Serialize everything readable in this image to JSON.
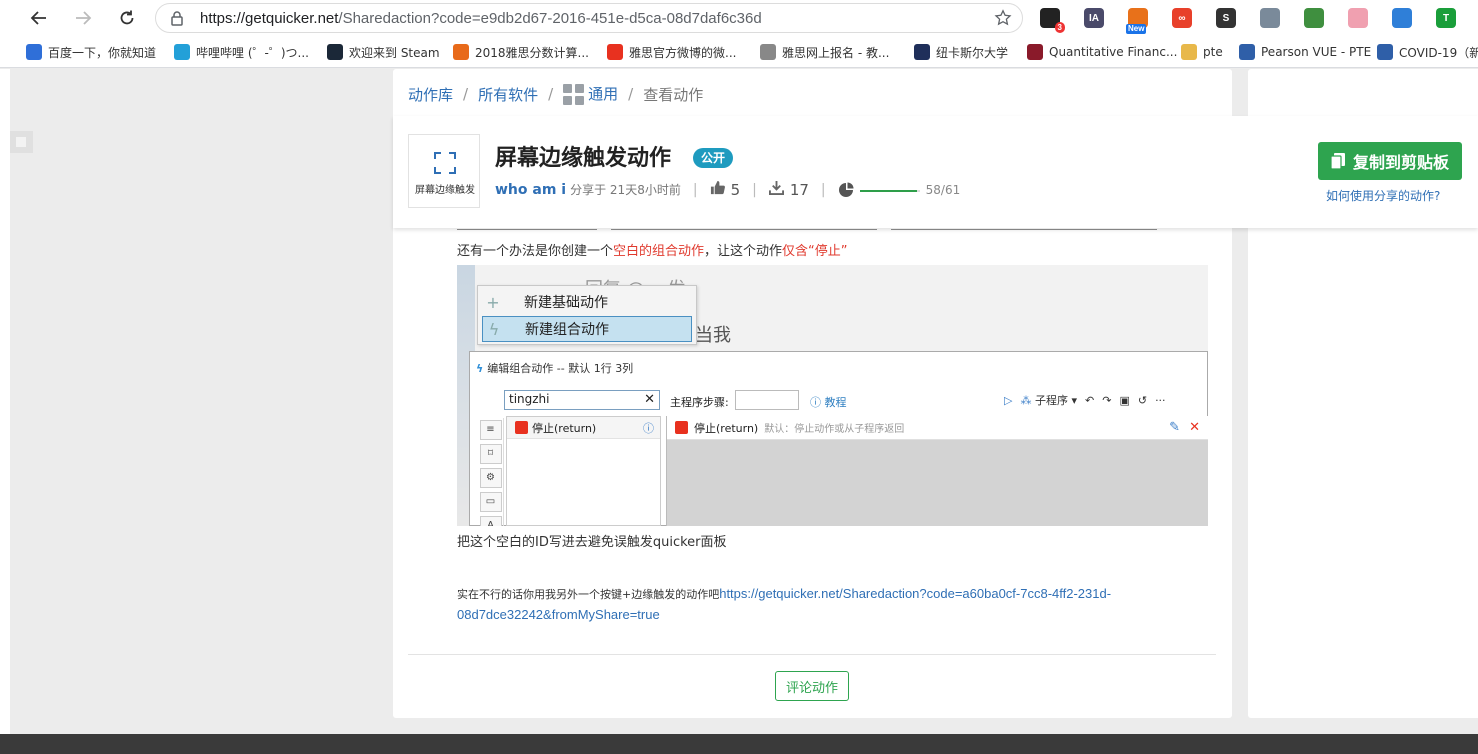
{
  "browser": {
    "url_host": "https://getquicker.net",
    "url_rest": "/Sharedaction?code=e9db2d67-2016-451e-d5ca-08d7daf6c36d",
    "extensions": [
      {
        "name": "extension-1-icon",
        "text": "",
        "color": "#222222",
        "badge": "3"
      },
      {
        "name": "extension-ia-icon",
        "text": "IA",
        "color": "#4a4a6a",
        "badge": ""
      },
      {
        "name": "extension-new-icon",
        "text": "",
        "color": "#e8711a",
        "badge": "New"
      },
      {
        "name": "extension-infinity-icon",
        "text": "∞",
        "color": "#e8402a",
        "badge": ""
      },
      {
        "name": "extension-s-icon",
        "text": "S",
        "color": "#333333",
        "badge": ""
      },
      {
        "name": "extension-chart-icon",
        "text": "",
        "color": "#7a8a9a",
        "badge": ""
      },
      {
        "name": "extension-globe-icon",
        "text": "",
        "color": "#3f8f3f",
        "badge": ""
      },
      {
        "name": "extension-cat-icon",
        "text": "",
        "color": "#f0a0b0",
        "badge": ""
      },
      {
        "name": "extension-earth-icon",
        "text": "",
        "color": "#2f7fd8",
        "badge": ""
      },
      {
        "name": "extension-shield-icon",
        "text": "T",
        "color": "#1a9e3a",
        "badge": ""
      }
    ]
  },
  "bookmarks": [
    {
      "label": "百度一下，你就知道",
      "icon": "paw-icon",
      "color": "#2f6fd8"
    },
    {
      "label": "哔哩哔哩 (゜-゜)つ...",
      "icon": "tv-icon",
      "color": "#23a0d8"
    },
    {
      "label": "欢迎来到 Steam",
      "icon": "steam-icon",
      "color": "#1b2838"
    },
    {
      "label": "2018雅思分数计算...",
      "icon": "headphones-icon",
      "color": "#e86a1a"
    },
    {
      "label": "雅思官方微博的微...",
      "icon": "weibo-icon",
      "color": "#e8311f"
    },
    {
      "label": "雅思网上报名 - 教...",
      "icon": "page-icon",
      "color": "#888888"
    },
    {
      "label": "纽卡斯尔大学",
      "icon": "crest-icon",
      "color": "#1f2f5a"
    },
    {
      "label": "Quantitative Financ...",
      "icon": "crest-icon",
      "color": "#8a1a2a"
    },
    {
      "label": "pte",
      "icon": "folder-icon",
      "color": "#e8b84a"
    },
    {
      "label": "Pearson VUE - PTE",
      "icon": "pearson-icon",
      "color": "#2f5fa8"
    },
    {
      "label": "COVID-19（新",
      "icon": "pearson-icon",
      "color": "#2f5fa8"
    }
  ],
  "breadcrumb": {
    "library": "动作库",
    "all_software": "所有软件",
    "general": "通用",
    "current": "查看动作"
  },
  "action": {
    "thumb_label": "屏幕边缘触发",
    "title": "屏幕边缘触发动作",
    "badge": "公开",
    "author": "who am i",
    "shared_time": "分享于 21天8小时前",
    "likes": "5",
    "downloads": "17",
    "progress_text": "58/61",
    "progress_fraction": 0.951,
    "copy_button": "复制到剪贴板",
    "help_link": "如何使用分享的动作?"
  },
  "content": {
    "para1_a": "还有一个办法是你创建一个",
    "para1_red1": "空白的组合动作",
    "para1_b": "，让这个动作",
    "para1_red2": "仅含“停止”",
    "screenshot": {
      "bg_text1": "回复 @... 发",
      "bg_text2": "当我",
      "menu_item_1": "新建基础动作",
      "menu_item_2": "新建组合动作",
      "editor_title": "编辑组合动作 -- 默认 1行 3列",
      "search_value": "tingzhi",
      "steps_label": "主程序步骤:",
      "tutorial": "教程",
      "subprogram": "子程序",
      "list_item": "停止(return)",
      "panel_item": "停止(return)",
      "panel_desc": "默认：停止动作或从子程序返回"
    },
    "para2": "把这个空白的ID写进去避免误触发quicker面板",
    "para3_text": "实在不行的话你用我另外一个按键+边缘触发的动作吧",
    "para3_link": "https://getquicker.net/Sharedaction?code=a60ba0cf-7cc8-4ff2-231d-08d7dce32242&fromMyShare=true",
    "comment_button": "评论动作"
  }
}
